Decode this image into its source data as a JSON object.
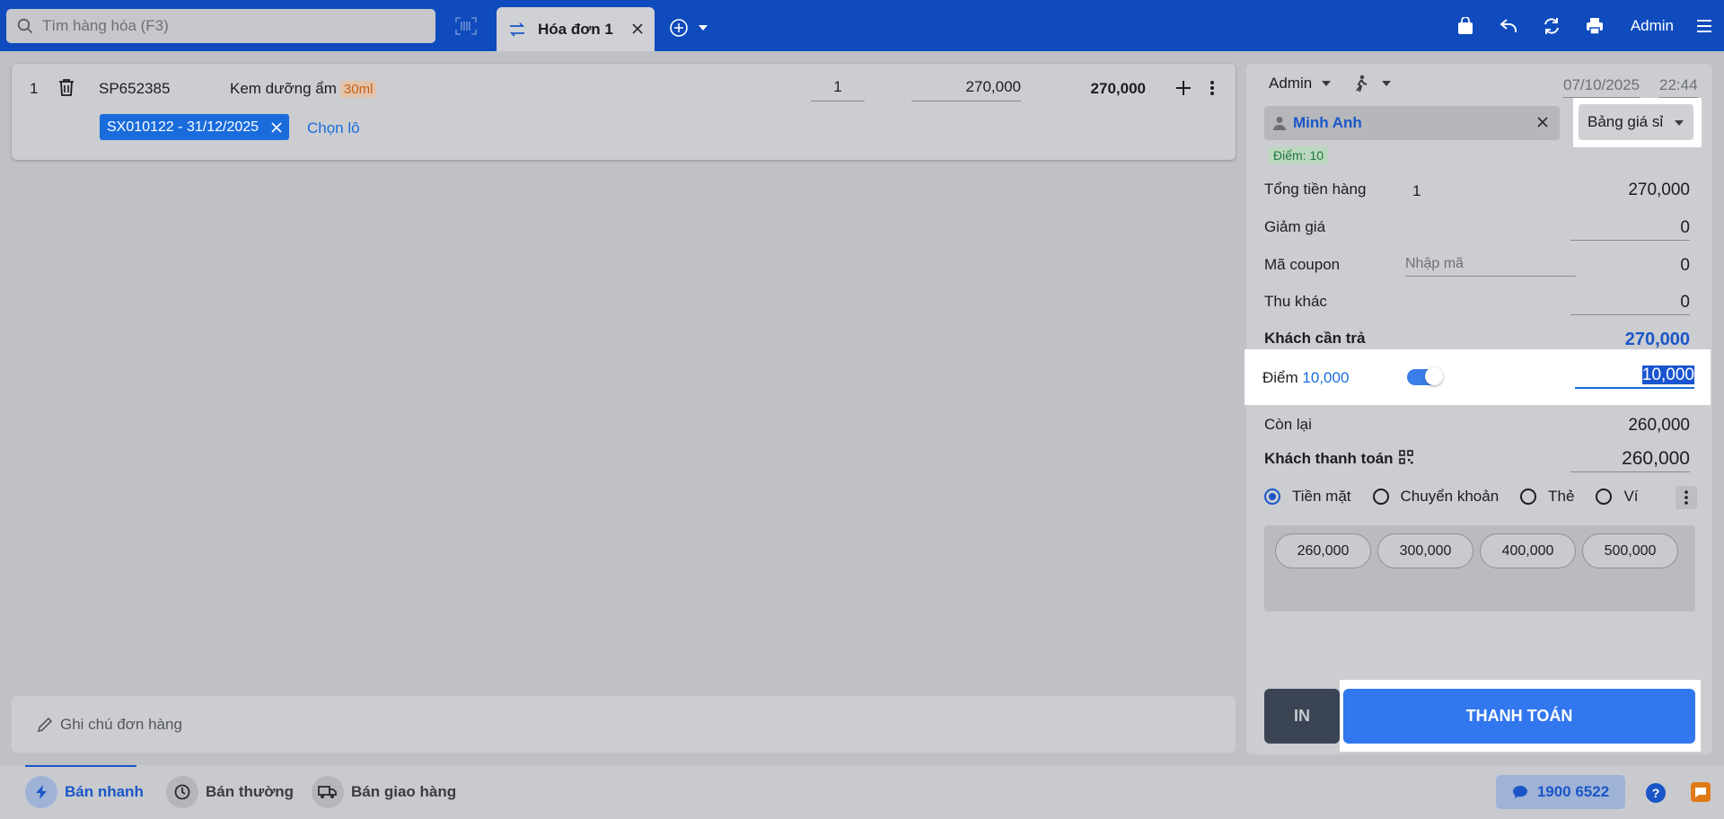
{
  "topbar": {
    "search_placeholder": "Tìm hàng hóa (F3)",
    "tab_label": "Hóa đơn 1",
    "user": "Admin",
    "icons": [
      "search-icon",
      "barcode-scan-icon",
      "swap-icon",
      "close-icon",
      "add-circle-icon",
      "chevron-down-icon",
      "shopping-bag-icon",
      "undo-icon",
      "refresh-icon",
      "print-icon",
      "menu-icon"
    ]
  },
  "cart": {
    "items": [
      {
        "index": "1",
        "code": "SP652385",
        "name": "Kem dưỡng ẩm",
        "unit_tag": "30ml",
        "qty": "1",
        "price": "270,000",
        "total": "270,000",
        "lot": "SX010122 - 31/12/2025",
        "choose_lot": "Chọn lô"
      }
    ],
    "note_placeholder": "Ghi chú đơn hàng"
  },
  "checkout": {
    "staff": "Admin",
    "date": "07/10/2025",
    "time": "22:44",
    "customer_name": "Minh Anh",
    "customer_points": "Điểm: 10",
    "price_book": "Bảng giá sỉ",
    "total_goods_label": "Tổng tiền hàng",
    "total_goods_count": "1",
    "total_goods_value": "270,000",
    "discount_label": "Giảm giá",
    "discount_value": "0",
    "coupon_label": "Mã coupon",
    "coupon_placeholder": "Nhập mã",
    "coupon_value": "0",
    "other_fee_label": "Thu khác",
    "other_fee_value": "0",
    "customer_pay_label": "Khách cần trả",
    "customer_pay_value": "270,000",
    "points_label": "Điểm",
    "points_available": "10,000",
    "points_used": "10,000",
    "points_toggle_on": true,
    "remaining_label": "Còn lại",
    "remaining_value": "260,000",
    "customer_paid_label": "Khách thanh toán",
    "customer_paid_value": "260,000",
    "payment_methods": [
      "Tiền mặt",
      "Chuyển khoản",
      "Thẻ",
      "Ví"
    ],
    "selected_method": "Tiền mặt",
    "quick_amounts": [
      "260,000",
      "300,000",
      "400,000",
      "500,000"
    ],
    "print_button": "IN",
    "pay_button": "THANH TOÁN"
  },
  "bottombar": {
    "modes": [
      "Bán nhanh",
      "Bán thường",
      "Bán giao hàng"
    ],
    "active_mode": "Bán nhanh",
    "hotline": "1900 6522",
    "help": "?"
  },
  "colors": {
    "header_bg": "#0f4bbd",
    "accent": "#1a56c8",
    "pay_button": "#3277ee",
    "print_button": "#3b4452"
  }
}
